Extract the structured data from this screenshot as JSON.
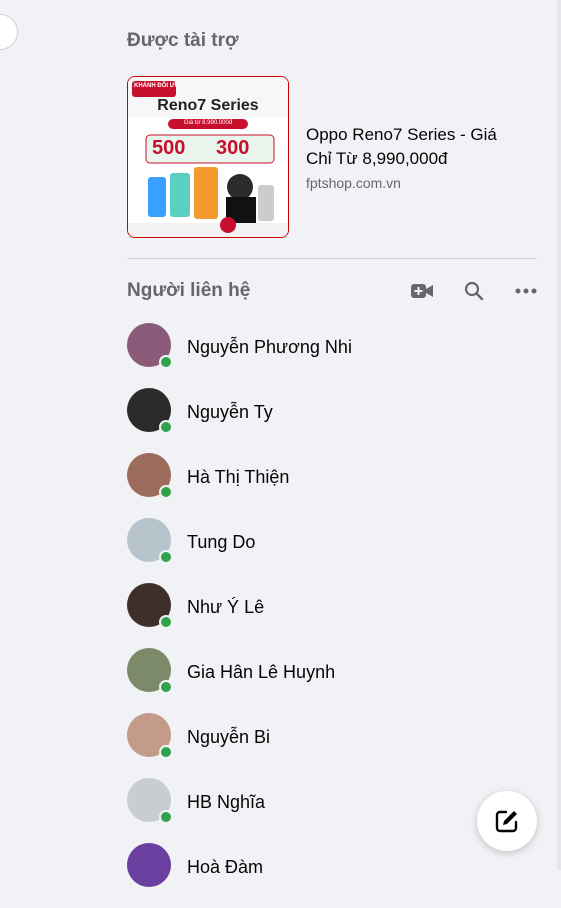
{
  "sponsored": {
    "title": "Được tài trợ",
    "ad": {
      "image_brand": "KHÁNH ĐỔI ƯU ĐÃI",
      "image_product": "Reno7 Series",
      "image_price_note": "Giá từ 8.990.000đ",
      "image_discount_1": "500",
      "image_discount_2": "300",
      "title": "Oppo Reno7 Series - Giá Chỉ Từ 8,990,000đ",
      "domain": "fptshop.com.vn"
    }
  },
  "contacts": {
    "title": "Người liên hệ",
    "icons": [
      "video-call-icon",
      "search-icon",
      "more-options-icon"
    ],
    "items": [
      {
        "name": "Nguyễn Phương Nhi",
        "online": true,
        "color": "#8a5a78"
      },
      {
        "name": "Nguyễn Ty",
        "online": true,
        "color": "#2b2b2b"
      },
      {
        "name": "Hà Thị Thiện",
        "online": true,
        "color": "#9b6b5c"
      },
      {
        "name": "Tung Do",
        "online": true,
        "color": "#b8c4cc"
      },
      {
        "name": "Như Ý Lê",
        "online": true,
        "color": "#3e2f2a"
      },
      {
        "name": "Gia Hân Lê Huynh",
        "online": true,
        "color": "#7d8a6a"
      },
      {
        "name": "Nguyễn Bi",
        "online": true,
        "color": "#c49a8a"
      },
      {
        "name": "HB Nghĩa",
        "online": true,
        "color": "#c9ccd1"
      },
      {
        "name": "Hoà Đàm",
        "online": false,
        "color": "#6b3fa0"
      }
    ]
  },
  "colors": {
    "online": "#31a24c",
    "accent": "#050505"
  }
}
